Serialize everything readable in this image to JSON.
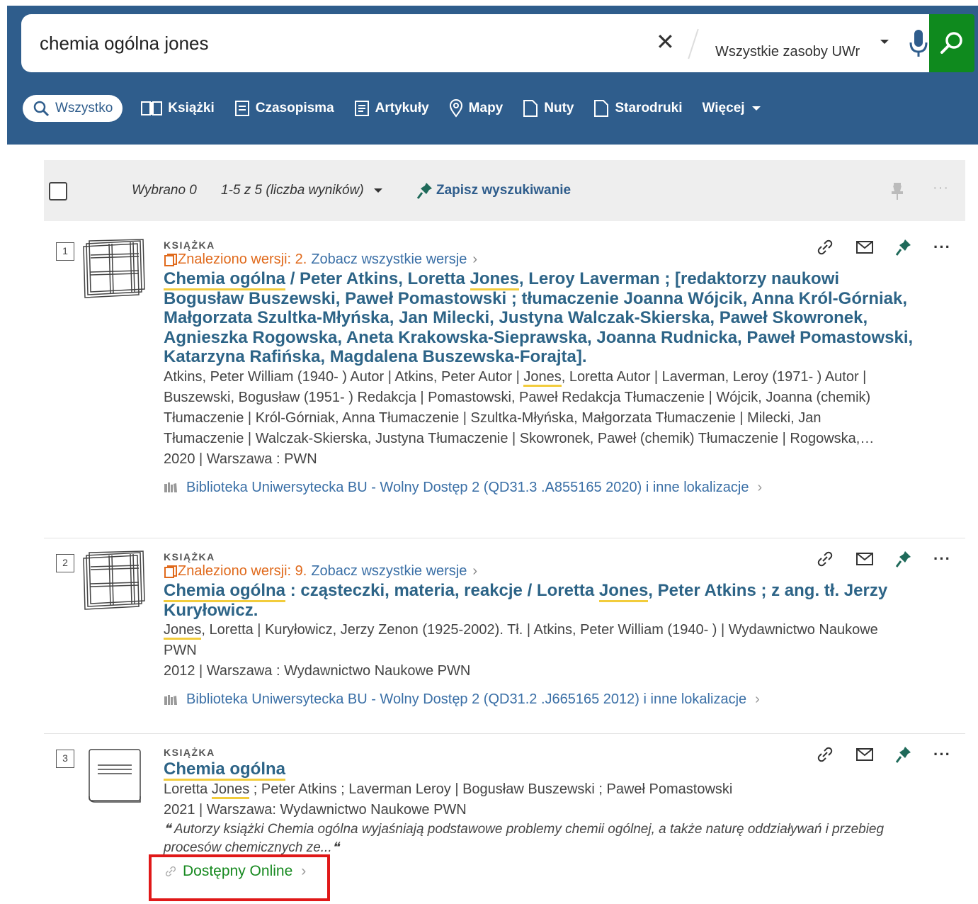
{
  "search": {
    "query": "chemia ogólna jones",
    "scope": "Wszystkie zasoby UWr"
  },
  "tabs": [
    {
      "label": "Wszystko",
      "icon": "search-icon"
    },
    {
      "label": "Książki",
      "icon": "book-open-icon"
    },
    {
      "label": "Czasopisma",
      "icon": "journal-icon"
    },
    {
      "label": "Artykuły",
      "icon": "article-icon"
    },
    {
      "label": "Mapy",
      "icon": "map-pin-icon"
    },
    {
      "label": "Nuty",
      "icon": "document-icon"
    },
    {
      "label": "Starodruki",
      "icon": "document-icon"
    },
    {
      "label": "Więcej",
      "icon": "chevron-down-icon"
    }
  ],
  "results_bar": {
    "selected": "Wybrano 0",
    "range": "1-5 z 5 (liczba wyników)",
    "save_search": "Zapisz wyszukiwanie",
    "more": "···"
  },
  "results": [
    {
      "number": "1",
      "type": "KSIĄŻKA",
      "versions_label": "Znaleziono wersji: 2.",
      "versions_link": "Zobacz wszystkie wersje",
      "title_hl1": "Chemia ogólna",
      "title_p1": " / Peter Atkins, Loretta ",
      "title_hl2": "Jones",
      "title_p2": ", Leroy Laverman ; [redaktorzy naukowi Bogusław Buszewski, Paweł Pomastowski ; tłumaczenie Joanna Wójcik, Anna Król-Górniak, Małgorzata Szultka-Młyńska, Jan Milecki, Justyna Walczak-Skierska, Paweł Skowronek, Agnieszka Rogowska, Aneta Krakowska-Sieprawska, Joanna Rudnicka, Paweł Pomastowski, Katarzyna Rafińska, Magdalena Buszewska-Forajta].",
      "authors_line1_a": "Atkins, Peter William (1940- ) Autor | Atkins, Peter Autor | ",
      "authors_line1_hl": "Jones",
      "authors_line1_b": ", Loretta Autor | Laverman, Leroy (1971- ) Autor |",
      "authors_line2": "Buszewski, Bogusław (1951- ) Redakcja | Pomastowski, Paweł Redakcja Tłumaczenie | Wójcik, Joanna (chemik)",
      "authors_line3": "Tłumaczenie | Król-Górniak, Anna Tłumaczenie | Szultka-Młyńska, Małgorzata Tłumaczenie | Milecki, Jan",
      "authors_line4": "Tłumaczenie | Walczak-Skierska, Justyna Tłumaczenie | Skowronek, Paweł (chemik) Tłumaczenie | Rogowska,…",
      "pub": "2020 | Warszawa : PWN",
      "location": "Biblioteka Uniwersytecka  BU - Wolny Dostęp 2 (QD31.3 .A855165 2020) i inne lokalizacje"
    },
    {
      "number": "2",
      "type": "KSIĄŻKA",
      "versions_label": "Znaleziono wersji: 9.",
      "versions_link": "Zobacz wszystkie wersje",
      "title_hl1": "Chemia ogólna",
      "title_p1": " : cząsteczki, materia, reakcje / Loretta ",
      "title_hl2": "Jones",
      "title_p2": ", Peter Atkins ; z ang. tł. Jerzy Kuryłowicz.",
      "authors_hl": "Jones",
      "authors_line1": ", Loretta | Kuryłowicz, Jerzy Zenon (1925-2002). Tł. | Atkins, Peter William (1940- ) | Wydawnictwo Naukowe",
      "authors_line2": "PWN",
      "pub": "2012 | Warszawa : Wydawnictwo Naukowe PWN",
      "location": "Biblioteka Uniwersytecka  BU - Wolny Dostęp 2 (QD31.2 .J665165 2012) i inne lokalizacje"
    },
    {
      "number": "3",
      "type": "KSIĄŻKA",
      "title": "Chemia ogólna",
      "authors_a": "Loretta ",
      "authors_hl": "Jones",
      "authors_b": " ; Peter Atkins ; Laverman Leroy | Bogusław Buszewski ; Paweł Pomastowski",
      "pub": "2021 | Warszawa: Wydawnictwo Naukowe PWN",
      "quote": "Autorzy książki Chemia ogólna wyjaśniają podstawowe problemy chemii ogólnej, a także naturę oddziaływań i przebieg procesów chemicznych ze...",
      "online": "Dostępny Online"
    }
  ],
  "colors": {
    "header_bg": "#2f5d8c",
    "search_btn": "#0f8a1e",
    "title": "#2d6487",
    "versions": "#e06a1c",
    "online": "#16891f",
    "highlight": "#f2cc3c",
    "callout": "#e01818"
  }
}
